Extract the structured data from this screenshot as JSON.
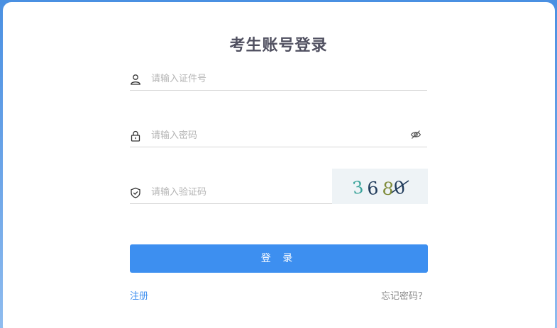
{
  "form": {
    "title": "考生账号登录",
    "username_placeholder": "请输入证件号",
    "password_placeholder": "请输入密码",
    "captcha_placeholder": "请输入验证码",
    "captcha_digits": [
      "3",
      "6",
      "8",
      "0"
    ],
    "login_label": "登 录",
    "register_label": "注册",
    "forgot_label": "忘记密码？"
  },
  "colors": {
    "primary": "#3d8ff0",
    "background": "#4a90e2",
    "title": "#505060",
    "placeholder": "#b4b4b4",
    "captcha_digit_1": "#3aa39a",
    "captcha_digit_2": "#1f3a5a",
    "captcha_digit_3": "#7f8c3a",
    "captcha_digit_4": "#1f3a5a"
  },
  "icons": {
    "username": "user-icon",
    "password": "lock-icon",
    "password_toggle": "eye-off-icon",
    "captcha": "shield-check-icon"
  }
}
